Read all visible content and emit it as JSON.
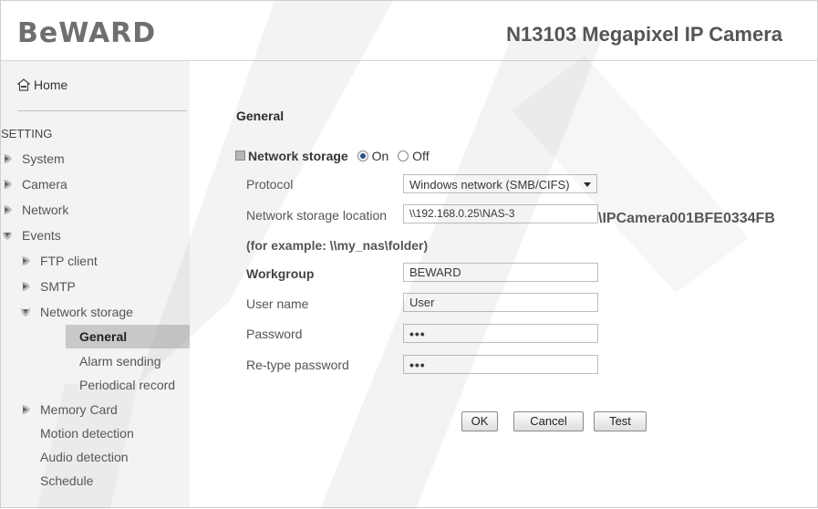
{
  "header": {
    "logo": "BeWARD",
    "product": "N13103 Megapixel IP Camera"
  },
  "sidebar": {
    "home": "Home",
    "setting": "SETTING",
    "items": [
      {
        "label": "System"
      },
      {
        "label": "Camera"
      },
      {
        "label": "Network"
      },
      {
        "label": "Events"
      },
      {
        "label": "FTP client"
      },
      {
        "label": "SMTP"
      },
      {
        "label": "Network storage"
      },
      {
        "label": "General"
      },
      {
        "label": "Alarm sending"
      },
      {
        "label": "Periodical record"
      },
      {
        "label": "Memory Card"
      },
      {
        "label": "Motion detection"
      },
      {
        "label": "Audio detection"
      },
      {
        "label": "Schedule"
      }
    ]
  },
  "main": {
    "title": "General",
    "network_storage": {
      "label": "Network storage",
      "on_label": "On",
      "off_label": "Off",
      "selected": "On"
    },
    "protocol": {
      "label": "Protocol",
      "value": "Windows network (SMB/CIFS)"
    },
    "location": {
      "label": "Network storage location",
      "value": "\\\\192.168.0.25\\NAS-3",
      "suffix": "\\IPCamera001BFE0334FB"
    },
    "example": "(for example: \\\\my_nas\\folder)",
    "workgroup": {
      "label": "Workgroup",
      "value": "BEWARD"
    },
    "username": {
      "label": "User name",
      "value": "User"
    },
    "password": {
      "label": "Password",
      "value": "•••"
    },
    "retype": {
      "label": "Re-type password",
      "value": "•••"
    },
    "buttons": {
      "ok": "OK",
      "cancel": "Cancel",
      "test": "Test"
    }
  }
}
